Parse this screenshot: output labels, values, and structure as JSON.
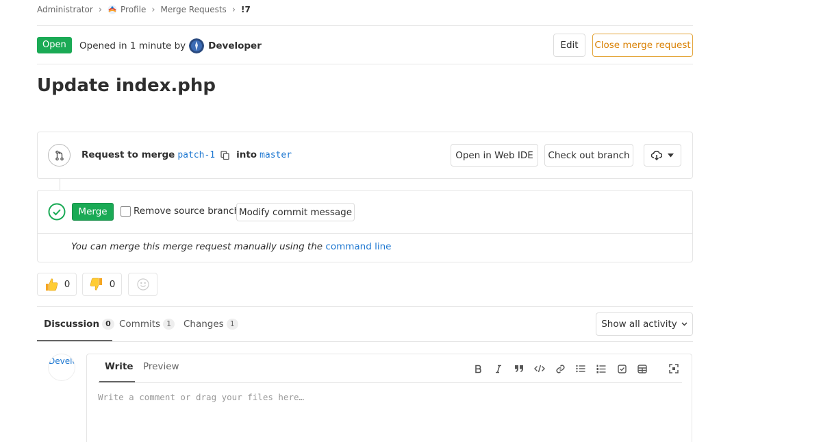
{
  "breadcrumb": {
    "items": [
      "Administrator",
      "Profile",
      "Merge Requests"
    ],
    "current": "!7"
  },
  "header": {
    "status": "Open",
    "opened_text": "Opened in 1 minute by",
    "author": "Developer",
    "edit_label": "Edit",
    "close_label": "Close merge request"
  },
  "title": "Update index.php",
  "merge_info": {
    "request_label": "Request to merge",
    "source_branch": "patch-1",
    "into_label": "into",
    "target_branch": "master",
    "web_ide_label": "Open in Web IDE",
    "checkout_label": "Check out branch"
  },
  "merge_widget": {
    "merge_label": "Merge",
    "remove_source_label": "Remove source branch",
    "modify_commit_label": "Modify commit message",
    "manual_text": "You can merge this merge request manually using the",
    "command_line_link": "command line"
  },
  "awards": {
    "thumbs_up_count": "0",
    "thumbs_down_count": "0"
  },
  "tabs": [
    {
      "label": "Discussion",
      "count": "0"
    },
    {
      "label": "Commits",
      "count": "1"
    },
    {
      "label": "Changes",
      "count": "1"
    }
  ],
  "activity_filter": "Show all activity",
  "comment": {
    "avatar_text": "Developer",
    "write_tab": "Write",
    "preview_tab": "Preview",
    "placeholder": "Write a comment or drag your files here…",
    "toolbar_icons": [
      "bold-icon",
      "italic-icon",
      "quote-icon",
      "code-icon",
      "link-icon",
      "bullet-list-icon",
      "numbered-list-icon",
      "task-list-icon",
      "table-icon",
      "fullscreen-icon"
    ]
  },
  "colors": {
    "success": "#1aaa55",
    "link": "#1f78d1",
    "warning": "#d97f00"
  }
}
